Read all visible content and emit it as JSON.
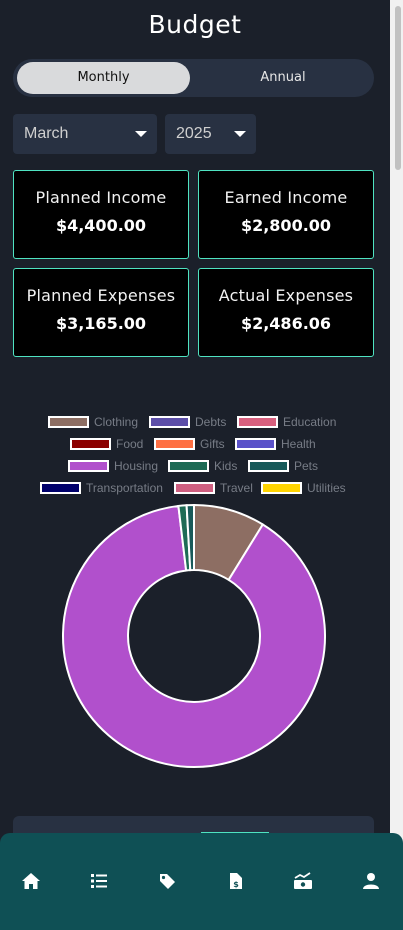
{
  "header": {
    "title": "Budget"
  },
  "period_toggle": {
    "monthly_label": "Monthly",
    "annual_label": "Annual",
    "selected": "Monthly"
  },
  "filters": {
    "month": "March",
    "year": "2025"
  },
  "summary": {
    "planned_income_label": "Planned Income",
    "planned_income_value": "$4,400.00",
    "earned_income_label": "Earned Income",
    "earned_income_value": "$2,800.00",
    "planned_expenses_label": "Planned Expenses",
    "planned_expenses_value": "$3,165.00",
    "actual_expenses_label": "Actual Expenses",
    "actual_expenses_value": "$2,486.06"
  },
  "colors": {
    "accent": "#4fe3c1",
    "background": "#1b202a",
    "navbar": "#0f5055",
    "panel": "#283142"
  },
  "chart_data": {
    "type": "doughnut",
    "legend": [
      {
        "name": "Clothing",
        "color": "#8d6e63"
      },
      {
        "name": "Debts",
        "color": "#5c4ea8"
      },
      {
        "name": "Education",
        "color": "#d8607e"
      },
      {
        "name": "Food",
        "color": "#8b0000"
      },
      {
        "name": "Gifts",
        "color": "#ff7043"
      },
      {
        "name": "Health",
        "color": "#5b52c9"
      },
      {
        "name": "Housing",
        "color": "#b150cc"
      },
      {
        "name": "Kids",
        "color": "#1e6b55"
      },
      {
        "name": "Pets",
        "color": "#185a5a"
      },
      {
        "name": "Transportation",
        "color": "#00006b"
      },
      {
        "name": "Travel",
        "color": "#cf5f80"
      },
      {
        "name": "Utilities",
        "color": "#ffd400"
      }
    ],
    "slices": [
      {
        "name": "Clothing",
        "percent": 8.8,
        "color": "#8d6e63"
      },
      {
        "name": "Housing",
        "percent": 89.3,
        "color": "#b150cc"
      },
      {
        "name": "Kids",
        "percent": 1.0,
        "color": "#1e6b55"
      },
      {
        "name": "Pets",
        "percent": 0.9,
        "color": "#185a5a"
      }
    ],
    "legend_placement": "top"
  },
  "nav": {
    "items": [
      {
        "icon": "home-icon"
      },
      {
        "icon": "list-icon"
      },
      {
        "icon": "tag-icon"
      },
      {
        "icon": "invoice-icon"
      },
      {
        "icon": "money-chart-icon"
      },
      {
        "icon": "user-icon"
      }
    ]
  }
}
